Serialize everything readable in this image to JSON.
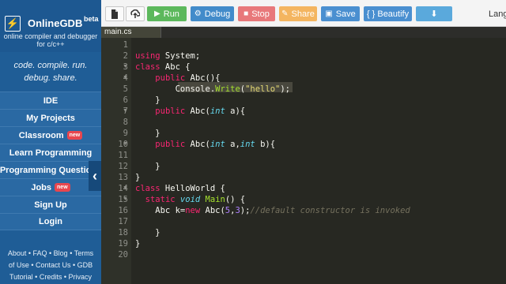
{
  "sidebar": {
    "logo_name": "OnlineGDB",
    "logo_beta": "beta",
    "logo_tagline_1": "online compiler and debugger",
    "logo_tagline_2": "for c/c++",
    "motto_1": "code. compile. run.",
    "motto_2": "debug. share.",
    "nav": [
      {
        "label": "IDE"
      },
      {
        "label": "My Projects"
      },
      {
        "label": "Classroom",
        "badge": "new"
      },
      {
        "label": "Learn Programming"
      },
      {
        "label": "Programming Questions"
      },
      {
        "label": "Jobs",
        "badge": "new"
      },
      {
        "label": "Sign Up"
      },
      {
        "label": "Login"
      }
    ],
    "footer": {
      "about": "About",
      "faq": "FAQ",
      "blog": "Blog",
      "terms": "Terms",
      "of_use": "of Use",
      "contact": "Contact Us",
      "gdb": "GDB",
      "tutorial": "Tutorial",
      "credits": "Credits",
      "privacy": "Privacy"
    }
  },
  "toolbar": {
    "run": "Run",
    "debug": "Debug",
    "stop": "Stop",
    "share": "Share",
    "save": "Save",
    "beautify": "{ } Beautify",
    "language_label": "Langu"
  },
  "editor": {
    "file_tab": "main.cs",
    "lines": [
      "",
      "using System;",
      "class Abc {",
      "    public Abc(){",
      "        Console.Write(\"hello\");",
      "    }",
      "    public Abc(int a){",
      "",
      "    }",
      "    public Abc(int a,int b){",
      "",
      "    }",
      "}",
      "class HelloWorld {",
      "  static void Main() {",
      "    Abc k=new Abc(5,3);//default constructor is invoked",
      "",
      "    }",
      "}",
      ""
    ]
  },
  "colors": {
    "sidebar_bg": "#1f5d96",
    "run_green": "#5cb85c",
    "debug_blue": "#428bca",
    "stop_red": "#e8787a",
    "share_orange": "#f4b560",
    "editor_bg": "#272822"
  }
}
